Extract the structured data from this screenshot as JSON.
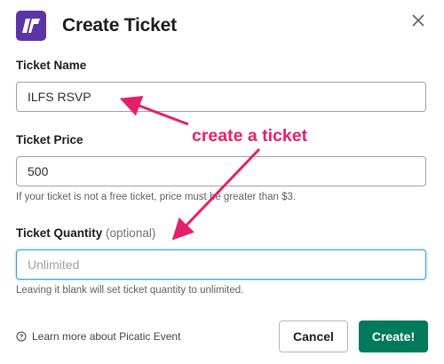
{
  "modal": {
    "title": "Create Ticket",
    "logo_icon": "picatic-logo-icon",
    "close_icon": "close-icon"
  },
  "fields": {
    "name": {
      "label": "Ticket Name",
      "value": "ILFS RSVP"
    },
    "price": {
      "label": "Ticket Price",
      "value": "500",
      "help": "If your ticket is not a free ticket, price must be greater than $3."
    },
    "quantity": {
      "label": "Ticket Quantity",
      "optional": "(optional)",
      "placeholder": "Unlimited",
      "value": "",
      "help": "Leaving it blank will set ticket quantity to unlimited."
    }
  },
  "annotation": {
    "text": "create a ticket",
    "color": "#e5206b"
  },
  "footer": {
    "learn_more": "Learn more about Picatic Event",
    "learn_icon": "question-circle-icon",
    "cancel_label": "Cancel",
    "create_label": "Create!"
  },
  "colors": {
    "brand": "#5b35a8",
    "primary": "#007a5a",
    "focus": "#2d9ee0"
  }
}
